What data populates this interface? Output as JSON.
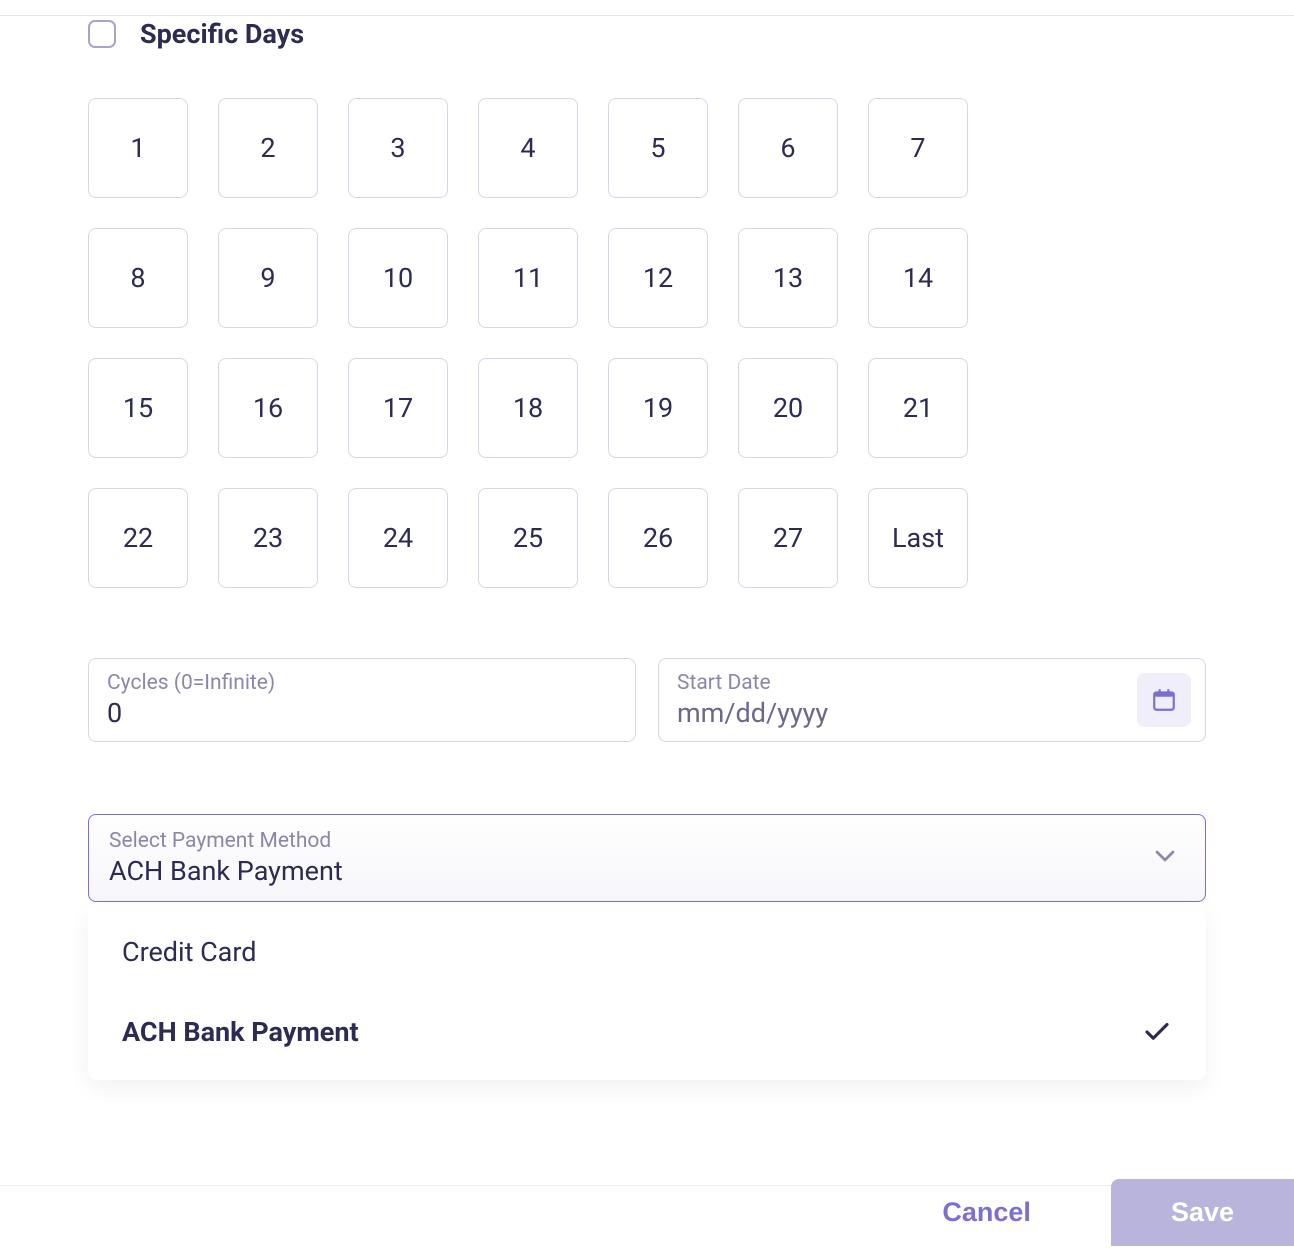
{
  "specificDays": {
    "label": "Specific Days",
    "checked": false
  },
  "days": [
    "1",
    "2",
    "3",
    "4",
    "5",
    "6",
    "7",
    "8",
    "9",
    "10",
    "11",
    "12",
    "13",
    "14",
    "15",
    "16",
    "17",
    "18",
    "19",
    "20",
    "21",
    "22",
    "23",
    "24",
    "25",
    "26",
    "27",
    "Last"
  ],
  "cycles": {
    "label": "Cycles (0=Infinite)",
    "value": "0"
  },
  "startDate": {
    "label": "Start Date",
    "placeholder": "mm/dd/yyyy"
  },
  "paymentMethod": {
    "label": "Select Payment Method",
    "selected": "ACH Bank Payment",
    "options": [
      {
        "label": "Credit Card",
        "selected": false
      },
      {
        "label": "ACH Bank Payment",
        "selected": true
      }
    ]
  },
  "actions": {
    "cancel": "Cancel",
    "save": "Save"
  }
}
